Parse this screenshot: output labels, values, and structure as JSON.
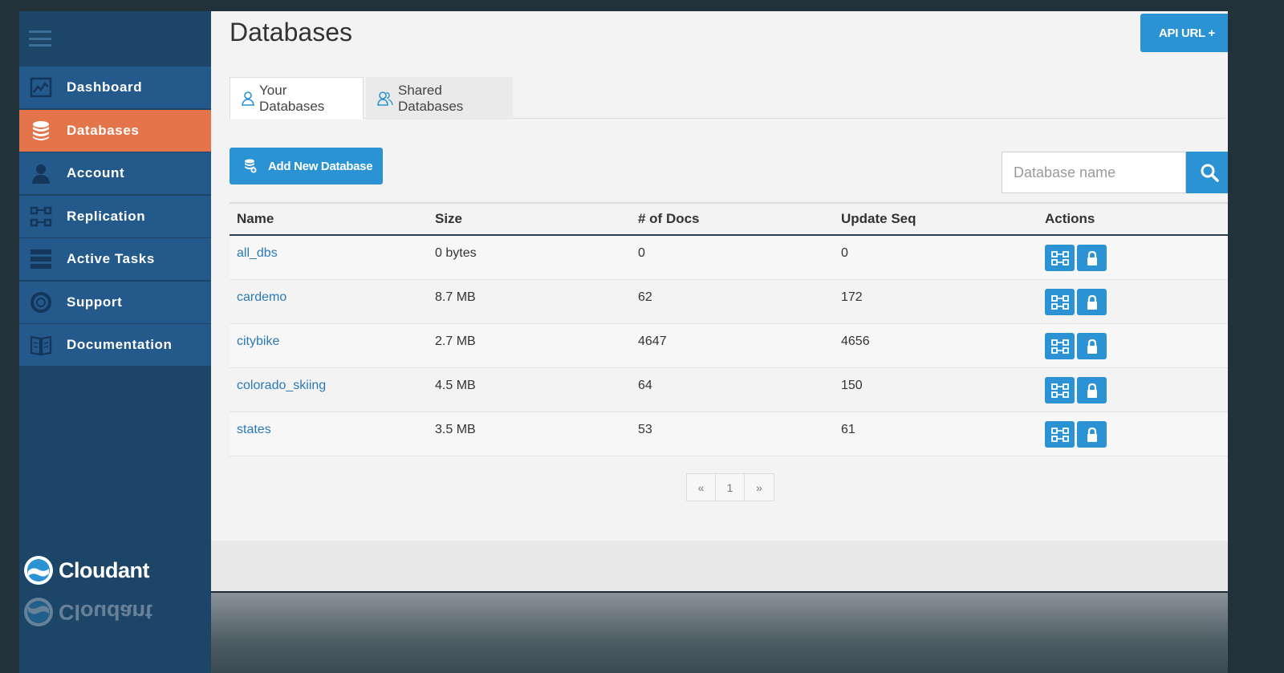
{
  "sidebar": {
    "items": [
      {
        "label": "Dashboard",
        "icon": "dashboard-chart-icon",
        "active": false
      },
      {
        "label": "Databases",
        "icon": "database-icon",
        "active": true
      },
      {
        "label": "Account",
        "icon": "user-icon",
        "active": false
      },
      {
        "label": "Replication",
        "icon": "replication-icon",
        "active": false
      },
      {
        "label": "Active Tasks",
        "icon": "tasks-icon",
        "active": false
      },
      {
        "label": "Support",
        "icon": "lifebuoy-icon",
        "active": false
      },
      {
        "label": "Documentation",
        "icon": "book-icon",
        "active": false
      }
    ],
    "brand": "Cloudant"
  },
  "header": {
    "title": "Databases",
    "api_button": "API URL +"
  },
  "tabs": [
    {
      "label": "Your Databases",
      "active": true
    },
    {
      "label": "Shared Databases",
      "active": false
    }
  ],
  "toolbar": {
    "add_button": "Add New Database",
    "search_placeholder": "Database name"
  },
  "table": {
    "columns": [
      "Name",
      "Size",
      "# of Docs",
      "Update Seq",
      "Actions"
    ],
    "rows": [
      {
        "name": "all_dbs",
        "size": "0 bytes",
        "docs": "0",
        "seq": "0"
      },
      {
        "name": "cardemo",
        "size": "8.7 MB",
        "docs": "62",
        "seq": "172"
      },
      {
        "name": "citybike",
        "size": "2.7 MB",
        "docs": "4647",
        "seq": "4656"
      },
      {
        "name": "colorado_skiing",
        "size": "4.5 MB",
        "docs": "64",
        "seq": "150"
      },
      {
        "name": "states",
        "size": "3.5 MB",
        "docs": "53",
        "seq": "61"
      }
    ]
  },
  "pagination": {
    "prev": "«",
    "current": "1",
    "next": "»"
  },
  "colors": {
    "sidebar": "#1d4568",
    "nav_item": "#24598b",
    "active": "#e4744a",
    "accent": "#2b93d3"
  }
}
